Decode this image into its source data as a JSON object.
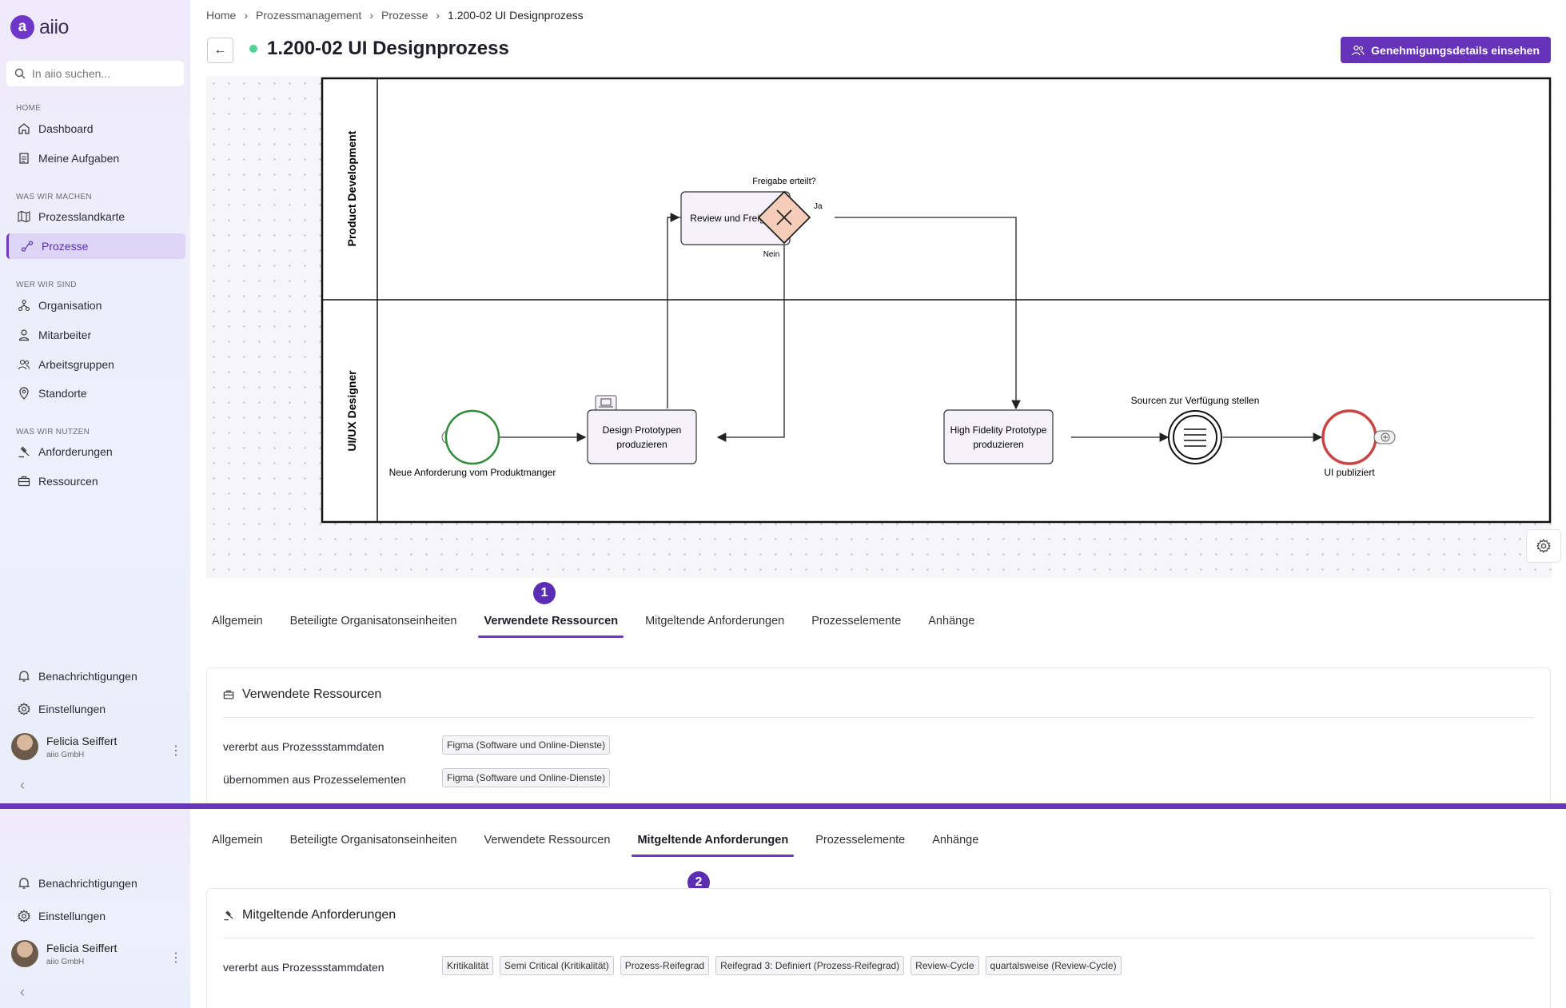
{
  "app": {
    "logo_text": "aiio"
  },
  "search": {
    "placeholder": "In aiio suchen..."
  },
  "sidebar": {
    "sections": [
      {
        "label": "HOME",
        "items": [
          {
            "label": "Dashboard",
            "icon": "home-icon"
          },
          {
            "label": "Meine Aufgaben",
            "icon": "tasks-icon"
          }
        ]
      },
      {
        "label": "WAS WIR MACHEN",
        "items": [
          {
            "label": "Prozesslandkarte",
            "icon": "map-icon"
          },
          {
            "label": "Prozesse",
            "icon": "process-icon",
            "active": true
          }
        ]
      },
      {
        "label": "WER WIR SIND",
        "items": [
          {
            "label": "Organisation",
            "icon": "org-icon"
          },
          {
            "label": "Mitarbeiter",
            "icon": "user-icon"
          },
          {
            "label": "Arbeitsgruppen",
            "icon": "group-icon"
          },
          {
            "label": "Standorte",
            "icon": "location-icon"
          }
        ]
      },
      {
        "label": "WAS WIR NUTZEN",
        "items": [
          {
            "label": "Anforderungen",
            "icon": "gavel-icon"
          },
          {
            "label": "Ressourcen",
            "icon": "briefcase-icon"
          }
        ]
      }
    ],
    "footer": {
      "notifications": "Benachrichtigungen",
      "settings": "Einstellungen"
    },
    "user": {
      "name": "Felicia Seiffert",
      "org": "aiio GmbH"
    }
  },
  "breadcrumb": [
    "Home",
    "Prozessmanagement",
    "Prozesse",
    "1.200-02 UI Designprozess"
  ],
  "page": {
    "title": "1.200-02 UI Designprozess",
    "status_color": "#4fd493"
  },
  "approval_button": {
    "label": "Genehmigungsdetails einsehen"
  },
  "diagram": {
    "lanes": [
      "Product Development",
      "UI/UX Designer"
    ],
    "tasks": {
      "review": "Review und Freigabe",
      "design_line1": "Design Prototypen",
      "design_line2": "produzieren",
      "hifi_line1": "High Fidelity Prototype",
      "hifi_line2": "produzieren"
    },
    "gateway": {
      "question": "Freigabe erteilt?",
      "yes": "Ja",
      "no": "Nein"
    },
    "events": {
      "start": "Neue Anforderung vom Produktmanger",
      "intermediate": "Sourcen zur Verfügung stellen",
      "end": "UI publiziert"
    }
  },
  "markers": {
    "first": "1",
    "second": "2"
  },
  "tabs": [
    "Allgemein",
    "Beteiligte Organisatonseinheiten",
    "Verwendete Ressourcen",
    "Mitgeltende Anforderungen",
    "Prozesselemente",
    "Anhänge"
  ],
  "resources_card": {
    "title": "Verwendete Ressourcen",
    "rows": [
      {
        "label": "vererbt aus Prozessstammdaten",
        "chips": [
          "Figma (Software und Online-Dienste)"
        ]
      },
      {
        "label": "übernommen aus Prozesselementen",
        "chips": [
          "Figma (Software und Online-Dienste)"
        ]
      }
    ]
  },
  "requirements_card": {
    "title": "Mitgeltende Anforderungen",
    "rows": [
      {
        "label": "vererbt aus Prozessstammdaten",
        "chips": [
          "Kritikalität",
          "Semi Critical (Kritikalität)",
          "Prozess-Reifegrad",
          "Reifegrad 3: Definiert (Prozess-Reifegrad)",
          "Review-Cycle",
          "quartalsweise (Review-Cycle)"
        ]
      }
    ]
  },
  "colors": {
    "accent": "#6f36c8",
    "start_event": "#2f8a3a",
    "end_event": "#c94545",
    "gateway_fill": "#f6cdb9"
  }
}
